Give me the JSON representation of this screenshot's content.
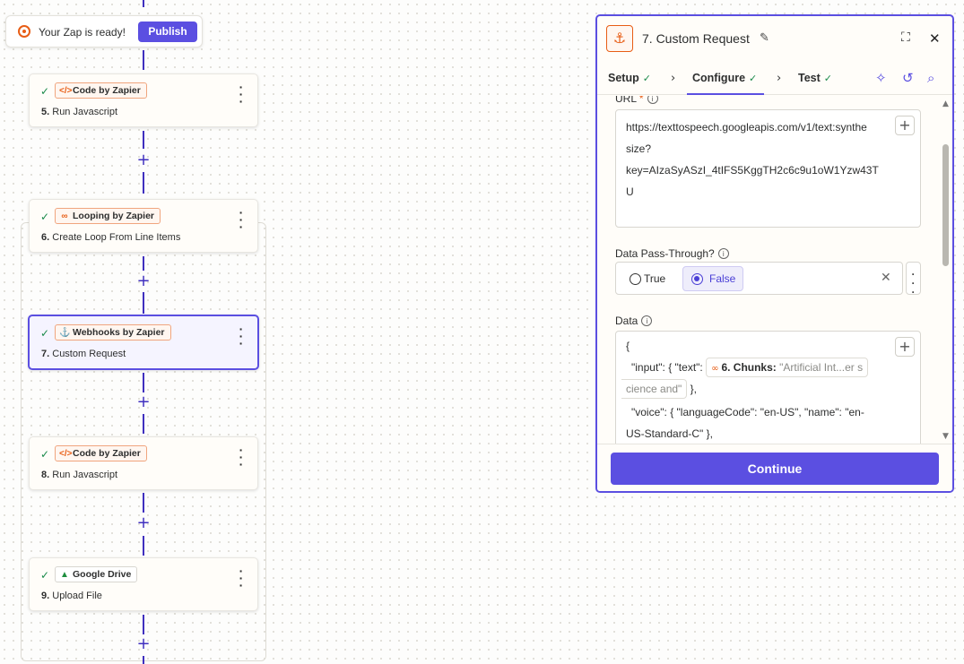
{
  "banner": {
    "message": "Your Zap is ready!",
    "publish_label": "Publish"
  },
  "steps": [
    {
      "app": "Code by Zapier",
      "icon": "code-icon",
      "number": "5.",
      "title": "Run Javascript"
    },
    {
      "app": "Looping by Zapier",
      "icon": "loop-icon",
      "number": "6.",
      "title": "Create Loop From Line Items"
    },
    {
      "app": "Webhooks by Zapier",
      "icon": "webhook-icon",
      "number": "7.",
      "title": "Custom Request"
    },
    {
      "app": "Code by Zapier",
      "icon": "code-icon",
      "number": "8.",
      "title": "Run Javascript"
    },
    {
      "app": "Google Drive",
      "icon": "google-drive-icon",
      "number": "9.",
      "title": "Upload File"
    }
  ],
  "panel": {
    "title": "7. Custom Request",
    "tabs": [
      {
        "label": "Setup"
      },
      {
        "label": "Configure"
      },
      {
        "label": "Test"
      }
    ],
    "url_field": {
      "label": "URL",
      "required_mark": "*",
      "lines": [
        "https://texttospeech.googleapis.com/v1/text:synthe",
        "size?",
        "key=AIzaSyASzI_4tIFS5KggTH2c6c9u1oW1Yzw43T",
        "U"
      ]
    },
    "pass_through": {
      "label": "Data Pass-Through?",
      "options": [
        "True",
        "False"
      ],
      "selected": "False"
    },
    "data_field": {
      "label": "Data",
      "line1": "{",
      "line2_prefix": "\"input\": { \"text\":",
      "token_label": "6. Chunks:",
      "token_value": "\"Artificial Int...er s",
      "line3_token_cont": "cience and\"",
      "line3_suffix": "},",
      "line4": "\"voice\": { \"languageCode\": \"en-US\", \"name\": \"en-",
      "line5": "US-Standard-C\" },"
    },
    "continue_label": "Continue"
  },
  "colors": {
    "accent": "#5b4fe1",
    "brand_orange": "#e85d15",
    "success": "#1a8a4a"
  }
}
